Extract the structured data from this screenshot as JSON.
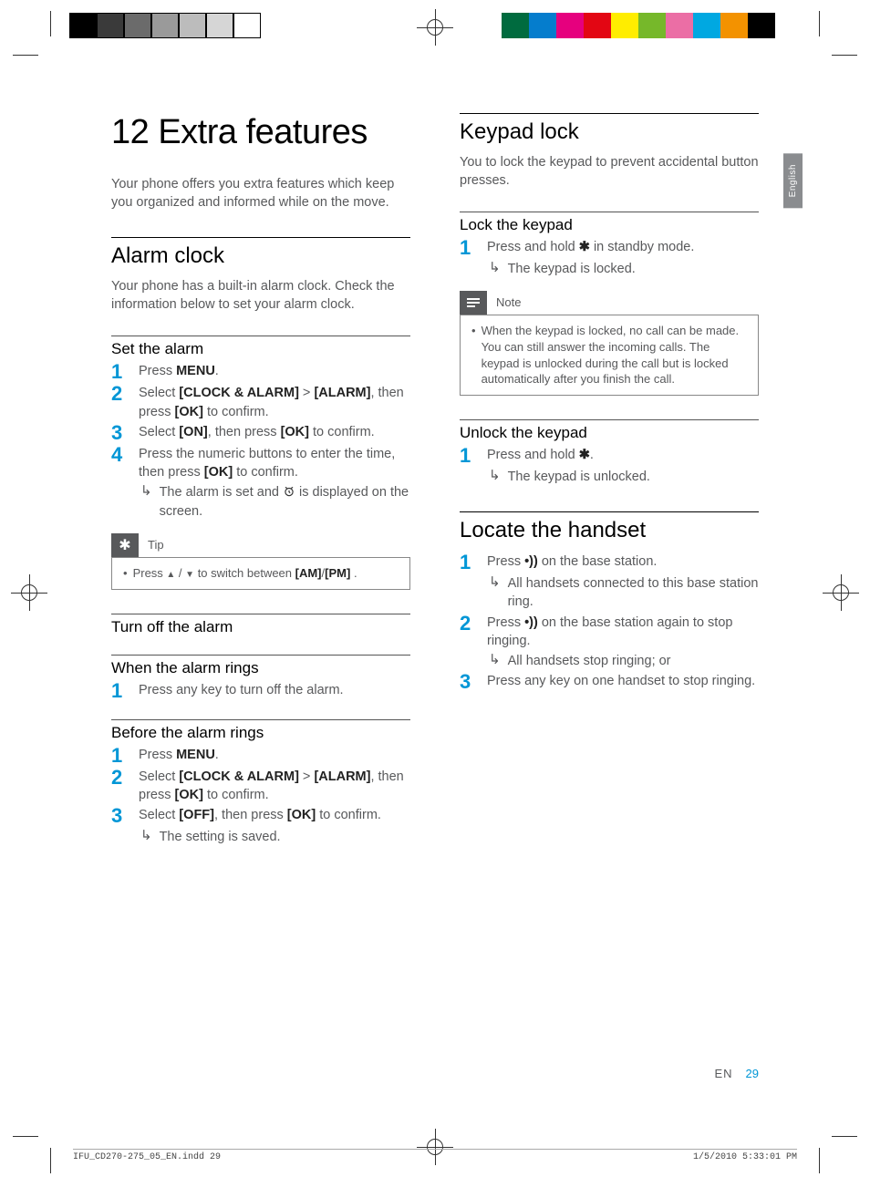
{
  "langtab": "English",
  "chapter_title": "12 Extra features",
  "col1": {
    "intro": "Your phone offers you extra features which keep you organized and informed while on the move.",
    "sec1": {
      "title": "Alarm clock",
      "intro": "Your phone has a built-in alarm clock. Check the information below to set your alarm clock.",
      "sub1": {
        "title": "Set the alarm",
        "steps": {
          "s1p": "Press ",
          "s1b": "MENU",
          "s1e": ".",
          "s2p": "Select ",
          "s2b1": "[CLOCK & ALARM]",
          "s2m": " > ",
          "s2b2": "[ALARM]",
          "s2m2": ", then press ",
          "s2b3": "[OK]",
          "s2e": " to confirm.",
          "s3p": "Select ",
          "s3b1": "[ON]",
          "s3m": ", then press ",
          "s3b2": "[OK]",
          "s3e": " to confirm.",
          "s4p": "Press the numeric buttons to enter the time, then press ",
          "s4b": "[OK]",
          "s4e": " to confirm.",
          "r4a": "The alarm is set and ",
          "r4b": " is displayed on the screen."
        }
      },
      "tip": {
        "label": "Tip",
        "pre": "Press ",
        "mid": " / ",
        "post": " to switch between ",
        "b1": "[AM]",
        "slash": "/",
        "b2": "[PM]",
        "end": " ."
      },
      "sub2": {
        "title": "Turn off the alarm"
      },
      "sub3": {
        "title": "When the alarm rings",
        "s1": "Press any key to turn off the alarm."
      },
      "sub4": {
        "title": "Before the alarm rings",
        "s1p": "Press ",
        "s1b": "MENU",
        "s1e": ".",
        "s2p": "Select ",
        "s2b1": "[CLOCK & ALARM]",
        "s2m": " > ",
        "s2b2": "[ALARM]",
        "s2m2": ", then press ",
        "s2b3": "[OK]",
        "s2e": " to confirm.",
        "s3p": "Select ",
        "s3b1": "[OFF]",
        "s3m": ", then press ",
        "s3b2": "[OK]",
        "s3e": " to confirm.",
        "r3": "The setting is saved."
      }
    }
  },
  "col2": {
    "sec1": {
      "title": "Keypad lock",
      "intro": "You to lock the keypad to prevent accidental button presses.",
      "sub1": {
        "title": "Lock the keypad",
        "s1a": "Press and hold ",
        "s1b": " in standby mode.",
        "r1": "The keypad is locked."
      },
      "note": {
        "label": "Note",
        "text": "When the keypad is locked, no call can be made. You can still answer the incoming calls. The keypad is unlocked during the call but is locked automatically after you finish the call."
      },
      "sub2": {
        "title": "Unlock the keypad",
        "s1a": "Press and hold ",
        "s1b": ".",
        "r1": "The keypad is unlocked."
      }
    },
    "sec2": {
      "title": "Locate the handset",
      "s1a": "Press ",
      "s1b": " on the base station.",
      "r1": "All handsets connected to this base station ring.",
      "s2a": "Press ",
      "s2b": " on the base station again to stop ringing.",
      "r2": "All handsets stop ringing; or",
      "s3": "Press any key on one handset to stop ringing."
    }
  },
  "footer": {
    "lang": "EN",
    "page": "29"
  },
  "printfoot": {
    "left": "IFU_CD270-275_05_EN.indd   29",
    "right": "1/5/2010   5:33:01 PM"
  },
  "icons": {
    "star_key": "✱",
    "alarm": "⏰",
    "up": "▲",
    "down": "▼",
    "note": "≡",
    "tip": "✱",
    "page_dot": "•))"
  }
}
